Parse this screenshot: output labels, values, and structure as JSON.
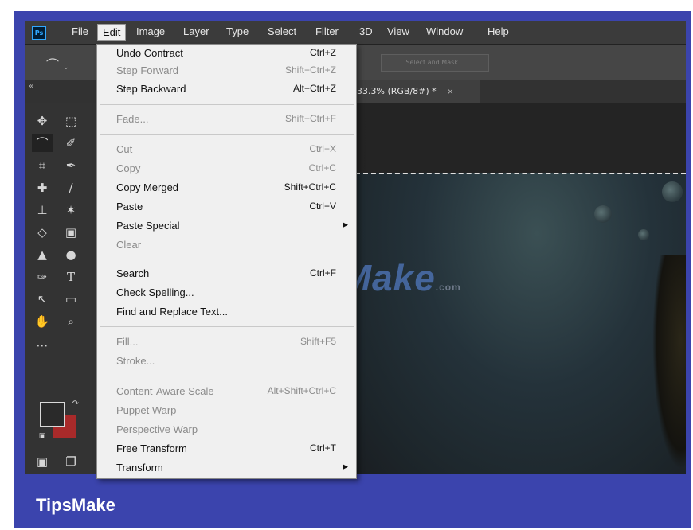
{
  "menubar": {
    "logo_text": "Ps",
    "items": [
      "File",
      "Edit",
      "Image",
      "Layer",
      "Type",
      "Select",
      "Filter",
      "3D",
      "View",
      "Window",
      "Help"
    ],
    "active": "Edit"
  },
  "options_bar": {
    "select_and_mask": "Select and Mask..."
  },
  "tab": {
    "collapse": "«",
    "doc_title": "33.3% (RGB/8#) *",
    "close": "×"
  },
  "edit_menu": {
    "items": [
      {
        "label": "Undo Contract",
        "shortcut": "Ctrl+Z",
        "enabled": true
      },
      {
        "label": "Step Forward",
        "shortcut": "Shift+Ctrl+Z",
        "enabled": false
      },
      {
        "label": "Step Backward",
        "shortcut": "Alt+Ctrl+Z",
        "enabled": true
      },
      {
        "label": "Fade...",
        "shortcut": "Shift+Ctrl+F",
        "enabled": false
      },
      {
        "label": "Cut",
        "shortcut": "Ctrl+X",
        "enabled": false
      },
      {
        "label": "Copy",
        "shortcut": "Ctrl+C",
        "enabled": false
      },
      {
        "label": "Copy Merged",
        "shortcut": "Shift+Ctrl+C",
        "enabled": true
      },
      {
        "label": "Paste",
        "shortcut": "Ctrl+V",
        "enabled": true
      },
      {
        "label": "Paste Special",
        "shortcut": "",
        "enabled": true,
        "submenu": true
      },
      {
        "label": "Clear",
        "shortcut": "",
        "enabled": false
      },
      {
        "label": "Search",
        "shortcut": "Ctrl+F",
        "enabled": true
      },
      {
        "label": "Check Spelling...",
        "shortcut": "",
        "enabled": true
      },
      {
        "label": "Find and Replace Text...",
        "shortcut": "",
        "enabled": true
      },
      {
        "label": "Fill...",
        "shortcut": "Shift+F5",
        "enabled": false
      },
      {
        "label": "Stroke...",
        "shortcut": "",
        "enabled": false
      },
      {
        "label": "Content-Aware Scale",
        "shortcut": "Alt+Shift+Ctrl+C",
        "enabled": false
      },
      {
        "label": "Puppet Warp",
        "shortcut": "",
        "enabled": false
      },
      {
        "label": "Perspective Warp",
        "shortcut": "",
        "enabled": false
      },
      {
        "label": "Free Transform",
        "shortcut": "Ctrl+T",
        "enabled": true
      },
      {
        "label": "Transform",
        "shortcut": "",
        "enabled": true,
        "submenu": true
      }
    ]
  },
  "tools": [
    "move-tool-icon",
    "marquee-tool-icon",
    "lasso-tool-icon",
    "quick-select-tool-icon",
    "crop-tool-icon",
    "eyedropper-tool-icon",
    "healing-brush-tool-icon",
    "brush-tool-icon",
    "clone-stamp-tool-icon",
    "history-brush-tool-icon",
    "eraser-tool-icon",
    "gradient-tool-icon",
    "blur-tool-icon",
    "dodge-tool-icon",
    "pen-tool-icon",
    "type-tool-icon",
    "path-select-tool-icon",
    "rectangle-tool-icon",
    "hand-tool-icon",
    "zoom-tool-icon"
  ],
  "colors": {
    "foreground": "#2a2a2a",
    "background": "#a82a2a",
    "frame": "#3b44ad"
  },
  "watermark": {
    "text": "TipsMake",
    "suffix": ".com"
  },
  "caption": "TipsMake"
}
